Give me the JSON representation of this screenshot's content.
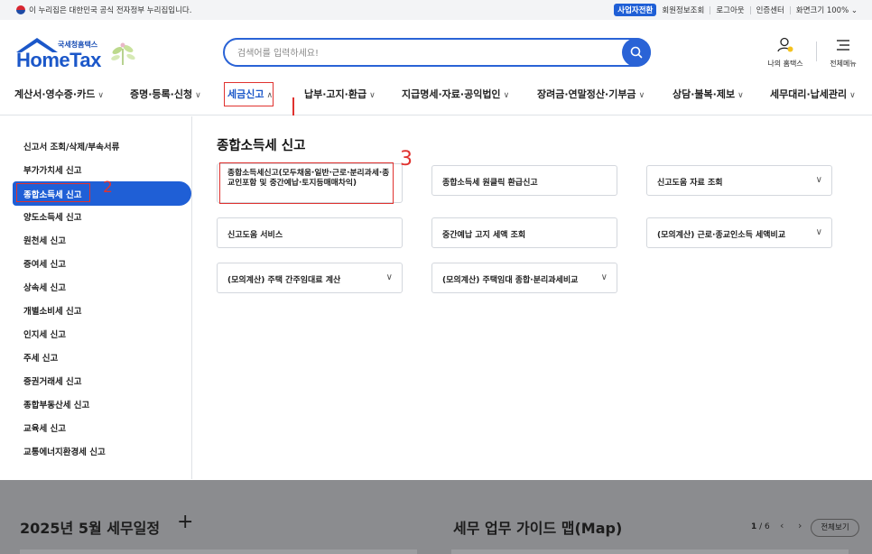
{
  "topbar": {
    "gov_notice": "이 누리집은 대한민국 공식 전자정부 누리집입니다.",
    "links": [
      "사업자전환",
      "회원정보조회",
      "로그아웃",
      "인증센터",
      "화면크기 100%"
    ]
  },
  "header": {
    "logo_sub": "국세청홈택스",
    "logo_main": "HomeTax",
    "search_placeholder": "검색어를 입력하세요!",
    "my_hometax": "나의 홈택스",
    "all_menu": "전체메뉴"
  },
  "gnb": [
    {
      "label": "계산서·영수증·카드"
    },
    {
      "label": "증명·등록·신청"
    },
    {
      "label": "세금신고"
    },
    {
      "label": "납부·고지·환급"
    },
    {
      "label": "지급명세·자료·공익법인"
    },
    {
      "label": "장려금·연말정산·기부금"
    },
    {
      "label": "상담·불복·제보"
    },
    {
      "label": "세무대리·납세관리"
    }
  ],
  "sidebar": [
    "신고서 조회/삭제/부속서류",
    "부가가치세 신고",
    "종합소득세 신고",
    "양도소득세 신고",
    "원천세 신고",
    "증여세 신고",
    "상속세 신고",
    "개별소비세 신고",
    "인지세 신고",
    "주세 신고",
    "증권거래세 신고",
    "종합부동산세 신고",
    "교육세 신고",
    "교통에너지환경세 신고"
  ],
  "content": {
    "title": "종합소득세 신고",
    "cards": [
      {
        "label": "종합소득세신고(모두채움·일반·근로·분리과세·종교인포함 및 중간예납·토지등매매차익)"
      },
      {
        "label": "종합소득세 원클릭 환급신고"
      },
      {
        "label": "신고도움 자료 조회"
      },
      {
        "label": "신고도움 서비스"
      },
      {
        "label": "중간예납 고지 세액 조회"
      },
      {
        "label": "(모의계산) 근로·종교인소득 세액비교"
      },
      {
        "label": "(모의계산) 주택 간주임대료 계산"
      },
      {
        "label": "(모의계산) 주택임대 종합·분리과세비교"
      }
    ]
  },
  "annotations": [
    "1",
    "2",
    "3"
  ],
  "bottom": {
    "schedule_title": "2025년 5월 세무일정",
    "guide_title": "세무 업무 가이드 맵(Map)",
    "page_current": "1",
    "page_total": "/ 6",
    "view_all": "전체보기"
  }
}
